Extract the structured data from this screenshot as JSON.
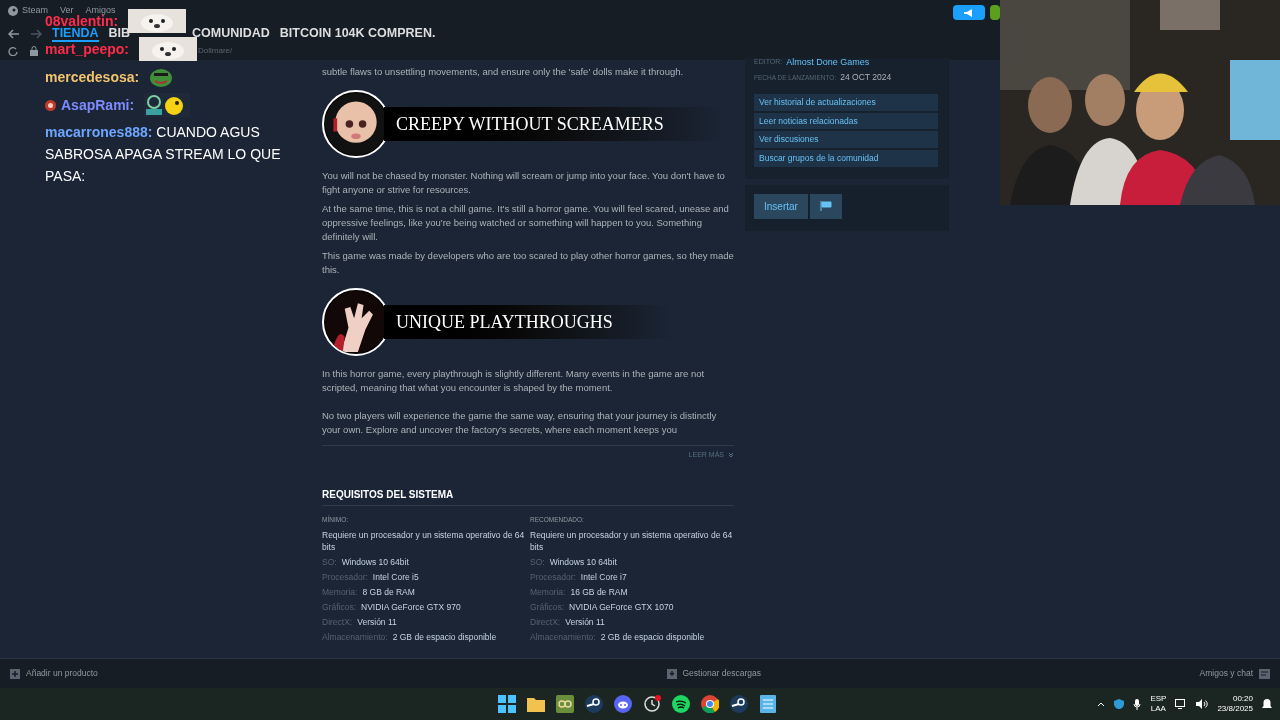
{
  "menu": [
    "Steam",
    "Ver",
    "Amigos"
  ],
  "nav": [
    {
      "label": "TIENDA",
      "selected": true
    },
    {
      "label": "BIB",
      "selected": false
    },
    {
      "label": "COMUNIDAD",
      "selected": false
    },
    {
      "label": "BITCOIN 104K COMPREN.",
      "selected": false
    }
  ],
  "url": "Dollmare/",
  "chat": [
    {
      "user": "08valentin:",
      "color": "#ff2b4a",
      "emote": {
        "kind": "dog"
      }
    },
    {
      "user": "mart_peepo:",
      "color": "#ff2b4a",
      "emote": {
        "kind": "dog"
      }
    },
    {
      "user": "mercedesosa:",
      "color": "#f3c46e",
      "emote": {
        "kind": "frog"
      }
    },
    {
      "user": "AsapRami:",
      "color": "#7d8bff",
      "emote": {
        "kind": "duck"
      },
      "badge": true
    },
    {
      "user": "macarrones888:",
      "color": "#6ea6ff",
      "message": "CUANDO AGUS SABROSA APAGA STREAM LO QUE PASA:"
    }
  ],
  "description": {
    "intro": "subtle flaws to unsettling movements, and ensure only the 'safe' dolls make it through.",
    "sections": [
      {
        "kind": "doll",
        "heading": "CREEPY WITHOUT SCREAMERS",
        "paragraphs": [
          "You will not be chased by monster. Nothing will scream or jump into your face. You don't have to fight anyone or strive for resources.",
          "At the same time, this is not a chill game. It's still a horror game. You will feel scared, unease and oppressive feelings, like you're being watched or something will happen to you. Something definitely will.",
          "This game was made by developers who are too scared to play other horror games, so they made this."
        ]
      },
      {
        "kind": "hand",
        "heading": "UNIQUE PLAYTHROUGHS",
        "paragraphs": [
          "In this horror game, every playthrough is slightly different. Many events in the game are not scripted, meaning that what you encounter is shaped by the moment.",
          "No two players will experience the game the same way, ensuring that your journey is distinctly your own. Explore and uncover the factory's secrets, where each moment keeps you"
        ]
      }
    ],
    "read_more": "LEER MÁS"
  },
  "requirements": {
    "title": "REQUISITOS DEL SISTEMA",
    "columns": [
      {
        "heading": "MÍNIMO:",
        "note": "Requiere un procesador y un sistema operativo de 64 bits",
        "rows": [
          {
            "label": "SO:",
            "value": "Windows 10 64bit"
          },
          {
            "label": "Procesador:",
            "value": "Intel Core i5"
          },
          {
            "label": "Memoria:",
            "value": "8 GB de RAM"
          },
          {
            "label": "Gráficos:",
            "value": "NVIDIA GeForce GTX 970"
          },
          {
            "label": "DirectX:",
            "value": "Versión 11"
          },
          {
            "label": "Almacenamiento:",
            "value": "2 GB de espacio disponible"
          }
        ]
      },
      {
        "heading": "RECOMENDADO:",
        "note": "Requiere un procesador y un sistema operativo de 64 bits",
        "rows": [
          {
            "label": "SO:",
            "value": "Windows 10 64bit"
          },
          {
            "label": "Procesador:",
            "value": "Intel Core i7"
          },
          {
            "label": "Memoria:",
            "value": "16 GB de RAM"
          },
          {
            "label": "Gráficos:",
            "value": "NVIDIA GeForce GTX 1070"
          },
          {
            "label": "DirectX:",
            "value": "Versión 11"
          },
          {
            "label": "Almacenamiento:",
            "value": "2 GB de espacio disponible"
          }
        ]
      }
    ]
  },
  "sidebar": {
    "publisher_label": "EDITOR:",
    "publisher": "Almost Done Games",
    "release_label": "FECHA DE LANZAMIENTO:",
    "release": "24 OCT 2024",
    "links": [
      "Ver historial de actualizaciones",
      "Leer noticias relacionadas",
      "Ver discusiones",
      "Buscar grupos de la comunidad"
    ],
    "embed": "Insertar"
  },
  "footer": {
    "add": "Añadir un producto",
    "downloads": "Gestionar descargas",
    "friends": "Amigos y chat"
  },
  "taskbar": {
    "apps": [
      {
        "kind": "start"
      },
      {
        "kind": "folder"
      },
      {
        "kind": "game"
      },
      {
        "kind": "steam"
      },
      {
        "kind": "discord"
      },
      {
        "kind": "clock"
      },
      {
        "kind": "spotify"
      },
      {
        "kind": "chrome"
      },
      {
        "kind": "steam"
      },
      {
        "kind": "notepad"
      }
    ],
    "lang": [
      "ESP",
      "LAA"
    ],
    "time": "00:20",
    "date": "23/8/2025"
  }
}
